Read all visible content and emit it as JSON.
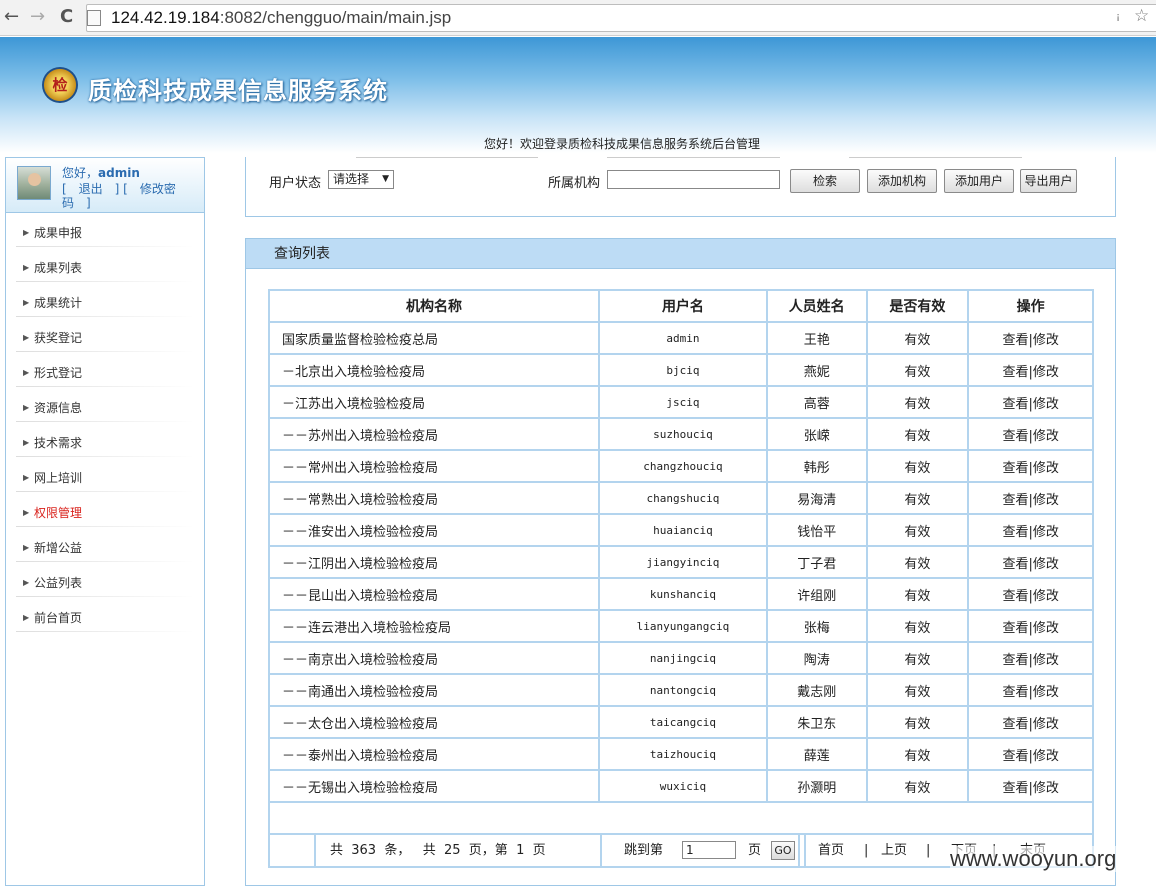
{
  "browser": {
    "url_host": "124.42.19.184",
    "url_rest": ":8082/chengguo/main/main.jsp",
    "back_icon": "←",
    "forward_icon": "→",
    "reload_icon": "C",
    "wrench_icon": "ꜟ",
    "star_icon": "☆"
  },
  "header": {
    "logo_text": "检",
    "title": "质检科技成果信息服务系统",
    "welcome": "您好！欢迎登录质检科技成果信息服务系统后台管理"
  },
  "sidebar": {
    "greeting": "您好，",
    "username": "admin",
    "links": "[　退出　] [　修改密码　]",
    "items": [
      {
        "label": "成果申报",
        "active": false
      },
      {
        "label": "成果列表",
        "active": false
      },
      {
        "label": "成果统计",
        "active": false
      },
      {
        "label": "获奖登记",
        "active": false
      },
      {
        "label": "形式登记",
        "active": false
      },
      {
        "label": "资源信息",
        "active": false
      },
      {
        "label": "技术需求",
        "active": false
      },
      {
        "label": "网上培训",
        "active": false
      },
      {
        "label": "权限管理",
        "active": true
      },
      {
        "label": "新增公益",
        "active": false
      },
      {
        "label": "公益列表",
        "active": false
      },
      {
        "label": "前台首页",
        "active": false
      }
    ]
  },
  "filter": {
    "status_label": "用户状态",
    "status_value": "请选择",
    "org_label": "所属机构",
    "org_value": "",
    "search_btn": "检索",
    "add_org_btn": "添加机构",
    "add_user_btn": "添加用户",
    "export_btn": "导出用户"
  },
  "list": {
    "title": "查询列表",
    "columns": [
      "机构名称",
      "用户名",
      "人员姓名",
      "是否有效",
      "操作"
    ],
    "view_label": "查看",
    "sep": "|",
    "edit_label": "修改",
    "rows": [
      {
        "org": "国家质量监督检验检疫总局",
        "user": "admin",
        "name": "王艳",
        "valid": "有效"
      },
      {
        "org": "－北京出入境检验检疫局",
        "user": "bjciq",
        "name": "燕妮",
        "valid": "有效"
      },
      {
        "org": "－江苏出入境检验检疫局",
        "user": "jsciq",
        "name": "高蓉",
        "valid": "有效"
      },
      {
        "org": "－－苏州出入境检验检疫局",
        "user": "suzhouciq",
        "name": "张嵘",
        "valid": "有效"
      },
      {
        "org": "－－常州出入境检验检疫局",
        "user": "changzhouciq",
        "name": "韩彤",
        "valid": "有效"
      },
      {
        "org": "－－常熟出入境检验检疫局",
        "user": "changshuciq",
        "name": "易海清",
        "valid": "有效"
      },
      {
        "org": "－－淮安出入境检验检疫局",
        "user": "huaianciq",
        "name": "钱怡平",
        "valid": "有效"
      },
      {
        "org": "－－江阴出入境检验检疫局",
        "user": "jiangyinciq",
        "name": "丁子君",
        "valid": "有效"
      },
      {
        "org": "－－昆山出入境检验检疫局",
        "user": "kunshanciq",
        "name": "许组刚",
        "valid": "有效"
      },
      {
        "org": "－－连云港出入境检验检疫局",
        "user": "lianyungangciq",
        "name": "张梅",
        "valid": "有效"
      },
      {
        "org": "－－南京出入境检验检疫局",
        "user": "nanjingciq",
        "name": "陶涛",
        "valid": "有效"
      },
      {
        "org": "－－南通出入境检验检疫局",
        "user": "nantongciq",
        "name": "戴志刚",
        "valid": "有效"
      },
      {
        "org": "－－太仓出入境检验检疫局",
        "user": "taicangciq",
        "name": "朱卫东",
        "valid": "有效"
      },
      {
        "org": "－－泰州出入境检验检疫局",
        "user": "taizhouciq",
        "name": "薛莲",
        "valid": "有效"
      },
      {
        "org": "－－无锡出入境检验检疫局",
        "user": "wuxiciq",
        "name": "孙灏明",
        "valid": "有效"
      }
    ]
  },
  "pager": {
    "summary": "共  363  条，   共  25  页，第  1  页",
    "jump_label": "跳到第",
    "jump_value": "1",
    "page_unit": "页",
    "go_label": "GO",
    "first": "首页",
    "prev": "上页",
    "next": "下页",
    "last": "末页"
  },
  "watermark": "www.wooyun.org"
}
